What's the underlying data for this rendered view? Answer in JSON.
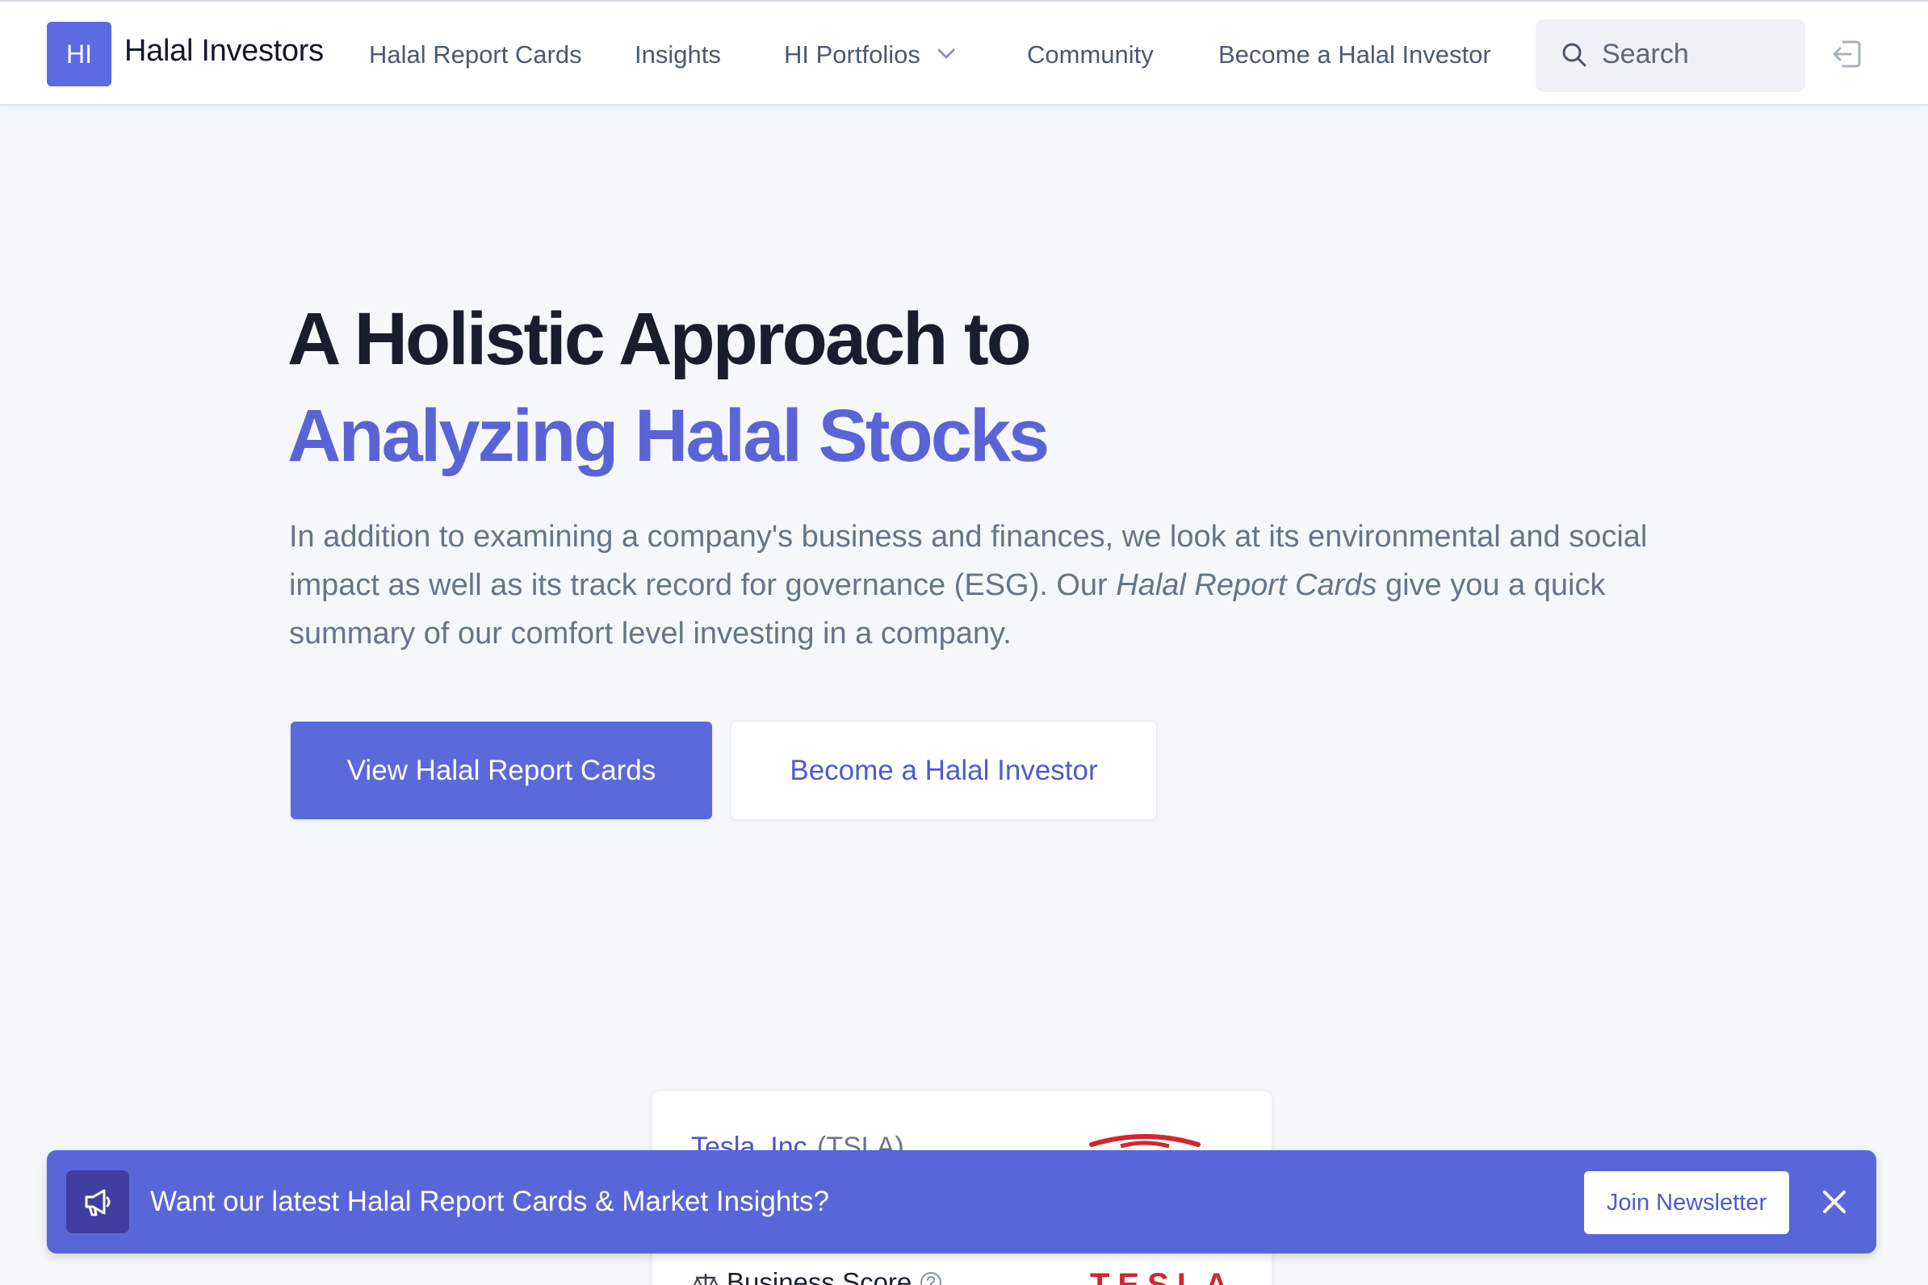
{
  "header": {
    "logo_text": "HI",
    "brand": "Halal Investors",
    "nav": [
      {
        "label": "Halal Report Cards"
      },
      {
        "label": "Insights"
      },
      {
        "label": "HI Portfolios"
      },
      {
        "label": "Community"
      },
      {
        "label": "Become a Halal Investor"
      }
    ],
    "search_placeholder": "Search"
  },
  "hero": {
    "title_line1": "A Holistic Approach to",
    "title_line2": "Analyzing Halal Stocks",
    "desc_part1": "In addition to examining a company's business and finances, we look at its environmental and social impact as well as its track record for governance (ESG). Our ",
    "desc_emphasis": "Halal Report Cards",
    "desc_part2": " give you a quick summary of our comfort level investing in a company.",
    "primary_button": "View Halal Report Cards",
    "secondary_button": "Become a Halal Investor"
  },
  "card": {
    "company": "Tesla, Inc.",
    "ticker": "(TSLA)",
    "score_label": "Business Score",
    "logo_word": "TESLA"
  },
  "banner": {
    "text": "Want our latest Halal Report Cards & Market Insights?",
    "button": "Join Newsletter"
  },
  "colors": {
    "accent": "#5b69db",
    "title_accent": "#5a64d6",
    "banner": "#5966d9",
    "tesla_red": "#d3262e"
  }
}
